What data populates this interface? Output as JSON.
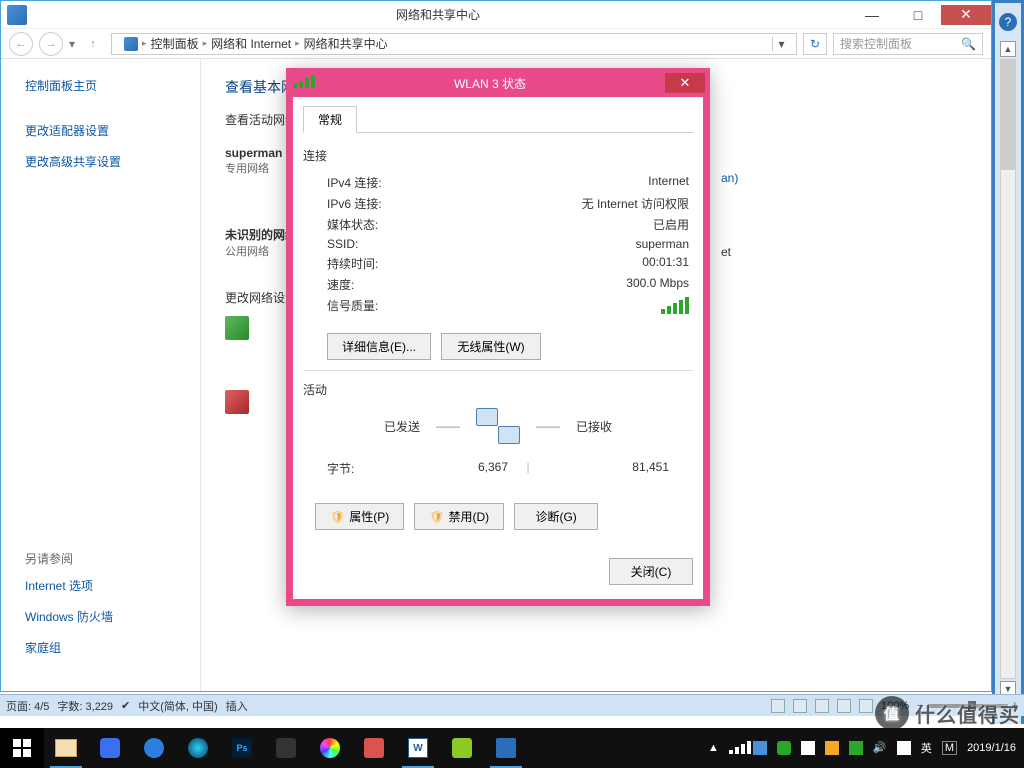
{
  "window": {
    "title": "网络和共享中心",
    "min": "—",
    "max": "□",
    "close": "✕"
  },
  "nav": {
    "back": "←",
    "forward": "→",
    "up": "▾",
    "bc1": "控制面板",
    "bc2": "网络和 Internet",
    "bc3": "网络和共享中心",
    "drop": "▾",
    "refresh": "↻",
    "search_placeholder": "搜索控制面板",
    "search_icon": "🔍"
  },
  "sidebar": {
    "home": "控制面板主页",
    "adapter": "更改适配器设置",
    "advshare": "更改高级共享设置",
    "see_also": "另请参阅",
    "inetopt": "Internet 选项",
    "firewall": "Windows 防火墙",
    "homegroup": "家庭组"
  },
  "main": {
    "h1": "查看基本网络信息并设置连接",
    "h2": "查看活动网络",
    "net1_name": "superman",
    "net1_type": "专用网络",
    "net1_link": "an)",
    "net2_name": "未识别的网络",
    "net2_type": "公用网络",
    "net2_link": "et",
    "change_title": "更改网络设置"
  },
  "dialog": {
    "title": "WLAN 3 状态",
    "close_x": "✕",
    "tab_general": "常规",
    "grp_conn": "连接",
    "ipv4_l": "IPv4 连接:",
    "ipv4_v": "Internet",
    "ipv6_l": "IPv6 连接:",
    "ipv6_v": "无 Internet 访问权限",
    "media_l": "媒体状态:",
    "media_v": "已启用",
    "ssid_l": "SSID:",
    "ssid_v": "superman",
    "dur_l": "持续时间:",
    "dur_v": "00:01:31",
    "speed_l": "速度:",
    "speed_v": "300.0 Mbps",
    "sig_l": "信号质量:",
    "btn_detail": "详细信息(E)...",
    "btn_wireless": "无线属性(W)",
    "grp_act": "活动",
    "sent": "已发送",
    "recv": "已接收",
    "bytes_l": "字节:",
    "bytes_sent": "6,367",
    "bytes_recv": "81,451",
    "btn_prop": "属性(P)",
    "btn_disable": "禁用(D)",
    "btn_diag": "诊断(G)",
    "btn_close": "关闭(C)"
  },
  "status": {
    "page": "页面: 4/5",
    "words": "字数: 3,229",
    "lang": "中文(简体, 中国)",
    "mode": "插入",
    "zoom": "100%",
    "zminus": "−",
    "zplus": "+"
  },
  "rightpane": {
    "help": "?",
    "up": "▲",
    "down": "▼"
  },
  "tray": {
    "ime1": "英",
    "ime2": "M",
    "time": "",
    "date": "2019/1/16"
  },
  "watermark": {
    "circ": "值",
    "text": "什么值得买"
  }
}
